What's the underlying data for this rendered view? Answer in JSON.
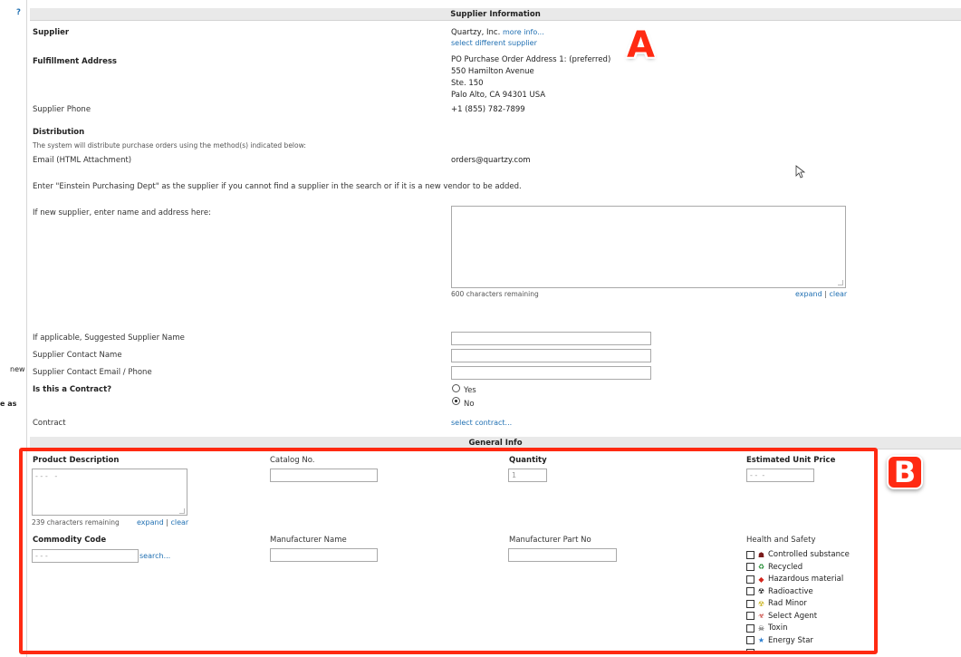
{
  "left_strip": {
    "help": "?",
    "snippet_new": "new",
    "snippet_eas": "e as"
  },
  "supplier_section": {
    "title": "Supplier Information",
    "supplier_label": "Supplier",
    "supplier_name": "Quartzy, Inc.",
    "more_info": "more info...",
    "select_different": "select different supplier",
    "fulfillment_label": "Fulfillment Address",
    "address_lines": [
      "PO Purchase Order Address 1: (preferred)",
      "550 Hamilton Avenue",
      "Ste. 150",
      "Palo Alto, CA 94301 USA"
    ],
    "phone_label": "Supplier Phone",
    "phone_value": "+1 (855) 782-7899",
    "distribution_label": "Distribution",
    "distribution_note": "The system will distribute purchase orders using the method(s) indicated below:",
    "email_method": "Email (HTML Attachment)",
    "email_value": "orders@quartzy.com",
    "instruction": "Enter \"Einstein Purchasing Dept\" as the supplier if you cannot find a supplier in the search or if it is a new vendor to be added.",
    "new_supplier_label": "If new supplier, enter name and address here:",
    "new_supplier_value": "",
    "chars_remaining": "600 characters remaining",
    "expand": "expand",
    "separator": "|",
    "clear": "clear",
    "suggested_name_label": "If applicable, Suggested Supplier Name",
    "contact_name_label": "Supplier Contact Name",
    "contact_email_label": "Supplier Contact Email / Phone",
    "contract_q_label": "Is this a Contract?",
    "yes": "Yes",
    "no": "No",
    "contract_label": "Contract",
    "select_contract": "select contract..."
  },
  "general_section": {
    "title": "General Info",
    "product_desc_label": "Product Description",
    "product_desc_value": "- - -   -",
    "chars_remaining": "239 characters remaining",
    "expand": "expand",
    "separator": "|",
    "clear": "clear",
    "catalog_label": "Catalog No.",
    "catalog_value": "",
    "quantity_label": "Quantity",
    "quantity_value": "1",
    "unit_price_label": "Estimated Unit Price",
    "unit_price_value": "- -  -",
    "commodity_label": "Commodity Code",
    "commodity_value": "- - -",
    "search_link": "search...",
    "manufacturer_label": "Manufacturer Name",
    "mfr_part_label": "Manufacturer Part No",
    "hs_label": "Health and Safety",
    "hs_items": [
      {
        "label": "Controlled substance",
        "icon": "controlled-substance-icon",
        "glyph": "☗",
        "color": "#7a1b1b"
      },
      {
        "label": "Recycled",
        "icon": "recycle-icon",
        "glyph": "♻",
        "color": "#1e8a2e"
      },
      {
        "label": "Hazardous material",
        "icon": "hazard-diamond-icon",
        "glyph": "◆",
        "color": "#d4261c"
      },
      {
        "label": "Radioactive",
        "icon": "radiation-icon",
        "glyph": "☢",
        "color": "#111111"
      },
      {
        "label": "Rad Minor",
        "icon": "rad-minor-icon",
        "glyph": "☢",
        "color": "#c9b21a"
      },
      {
        "label": "Select Agent",
        "icon": "biohazard-icon",
        "glyph": "☣",
        "color": "#c0271e"
      },
      {
        "label": "Toxin",
        "icon": "skull-icon",
        "glyph": "☠",
        "color": "#111111"
      },
      {
        "label": "Energy Star",
        "icon": "energy-star-icon",
        "glyph": "★",
        "color": "#2b7fd0"
      }
    ]
  },
  "annotations": {
    "a": "A",
    "b": "B",
    "red_color": "#ff2a12"
  }
}
